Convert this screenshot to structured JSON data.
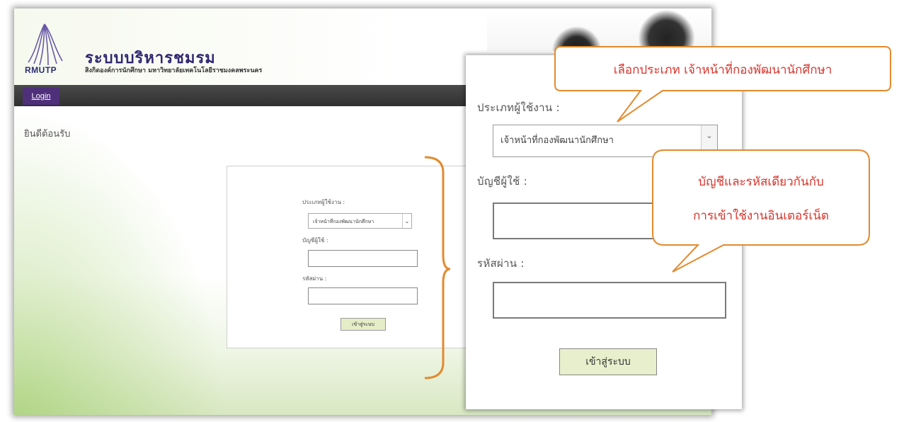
{
  "header": {
    "logo_text": "RMUTP",
    "title": "ระบบบริหารชมรม",
    "subtitle": "สิงกิดองค์การนักศึกษา มหาวิทยาลัยเทคโนโลยีราชมงคลพระนคร"
  },
  "nav": {
    "login_label": "Login"
  },
  "page": {
    "welcome": "ยินดีต้อนรับ"
  },
  "login_form": {
    "user_type_label": "ประเภทผู้ใช้งาน :",
    "user_type_value": "เจ้าหน้าที่กองพัฒนานักศึกษา",
    "account_label": "บัญชีผู้ใช้ :",
    "password_label": "รหัสผ่าน :",
    "submit_label": "เข้าสู่ระบบ"
  },
  "annotations": {
    "callout_1": "เลือกประเภท เจ้าหน้าที่กองพัฒนานักศึกษา",
    "callout_2_line1": "บัญชีและรหัสเดียวกันกับ",
    "callout_2_line2": "การเข้าใช้งานอินเตอร์เน็ต",
    "accent_color": "#e38a2e",
    "text_color": "#d9342b"
  }
}
